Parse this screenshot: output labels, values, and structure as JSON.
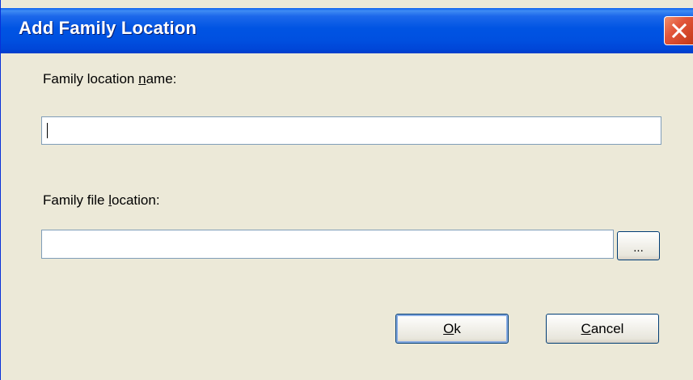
{
  "window": {
    "title": "Add Family Location",
    "close_icon": "close-icon"
  },
  "form": {
    "name_label_pre": "Family location ",
    "name_label_accel": "n",
    "name_label_post": "ame:",
    "name_value": "",
    "location_label_pre": "Family file ",
    "location_label_accel": "l",
    "location_label_post": "ocation:",
    "location_value": "",
    "browse_label": "..."
  },
  "buttons": {
    "ok_accel": "O",
    "ok_rest": "k",
    "cancel_accel": "C",
    "cancel_rest": "ancel"
  },
  "colors": {
    "titlebar": "#0054e3",
    "window_bg": "#ece9d8",
    "close_button": "#e2553a",
    "input_border": "#7f9db9"
  }
}
